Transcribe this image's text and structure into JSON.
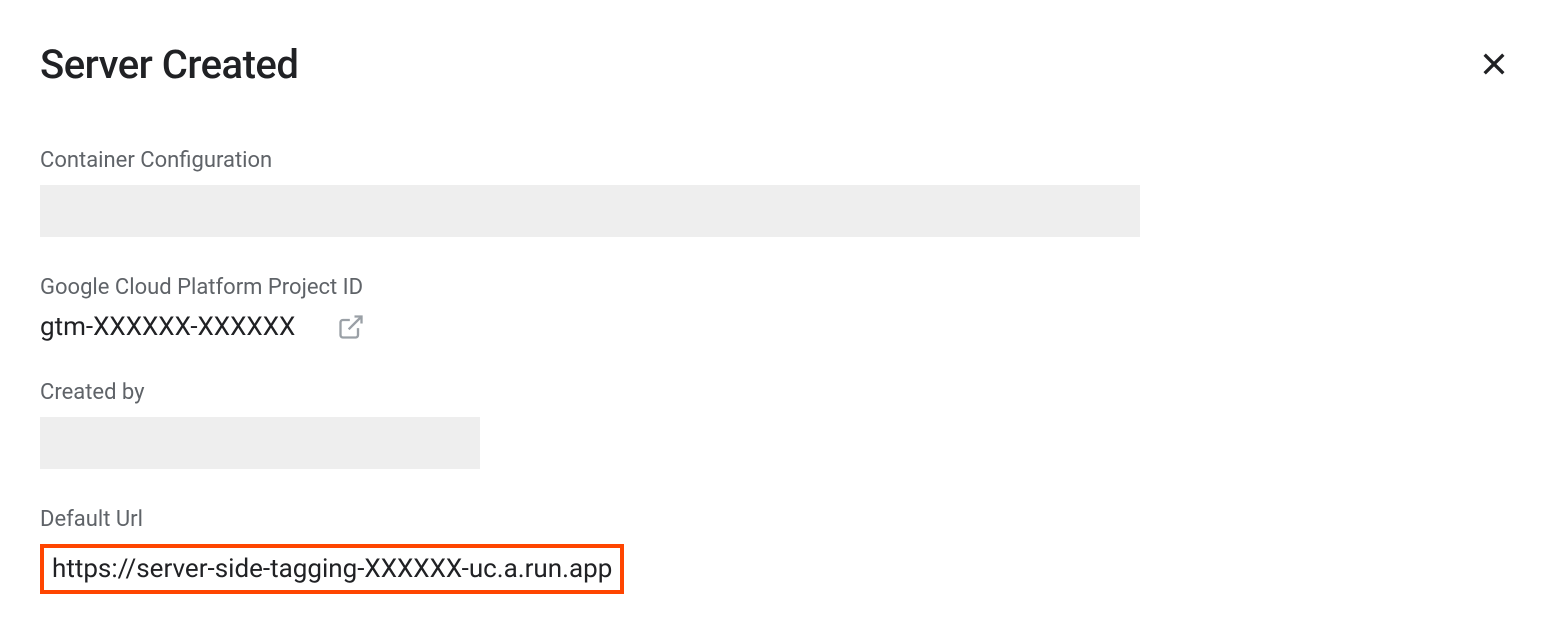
{
  "dialog": {
    "title": "Server Created",
    "fields": {
      "containerConfig": {
        "label": "Container Configuration"
      },
      "projectId": {
        "label": "Google Cloud Platform Project ID",
        "value": "gtm-XXXXXX-XXXXXX"
      },
      "createdBy": {
        "label": "Created by"
      },
      "defaultUrl": {
        "label": "Default Url",
        "value": "https://server-side-tagging-XXXXXX-uc.a.run.app"
      }
    }
  }
}
